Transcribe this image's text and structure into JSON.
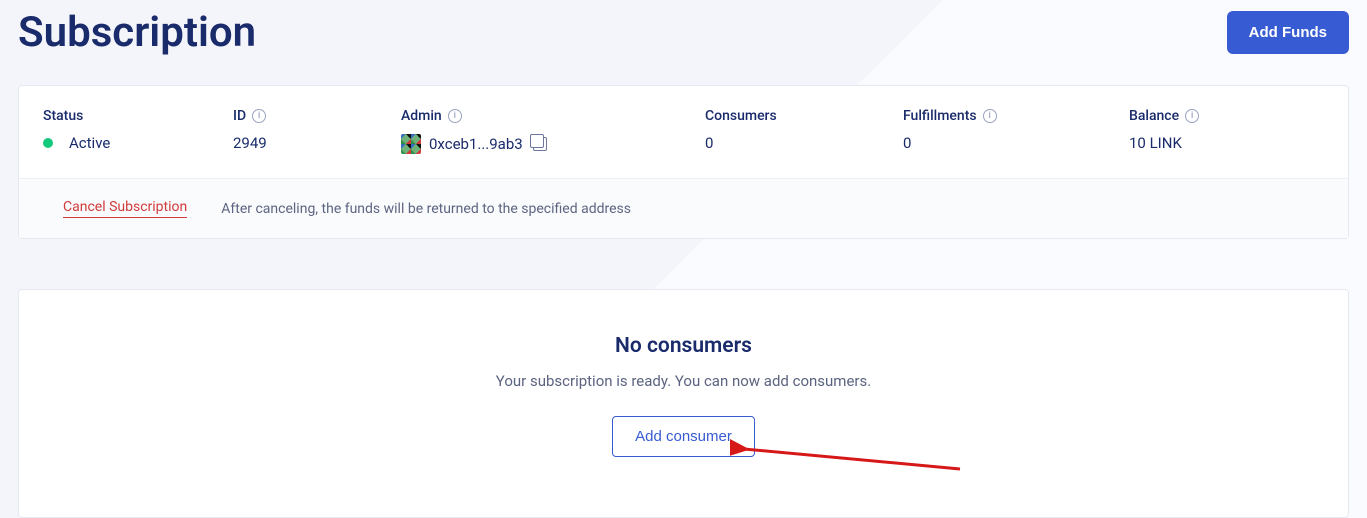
{
  "header": {
    "title": "Subscription",
    "add_funds_label": "Add Funds"
  },
  "stats": {
    "status": {
      "label": "Status",
      "value": "Active"
    },
    "id": {
      "label": "ID",
      "value": "2949"
    },
    "admin": {
      "label": "Admin",
      "value": "0xceb1...9ab3"
    },
    "consumers": {
      "label": "Consumers",
      "value": "0"
    },
    "fulfillments": {
      "label": "Fulfillments",
      "value": "0"
    },
    "balance": {
      "label": "Balance",
      "value": "10 LINK"
    }
  },
  "cancel": {
    "link_label": "Cancel Subscription",
    "description": "After canceling, the funds will be returned to the specified address"
  },
  "consumers_panel": {
    "title": "No consumers",
    "description": "Your subscription is ready. You can now add consumers.",
    "add_button_label": "Add consumer"
  }
}
